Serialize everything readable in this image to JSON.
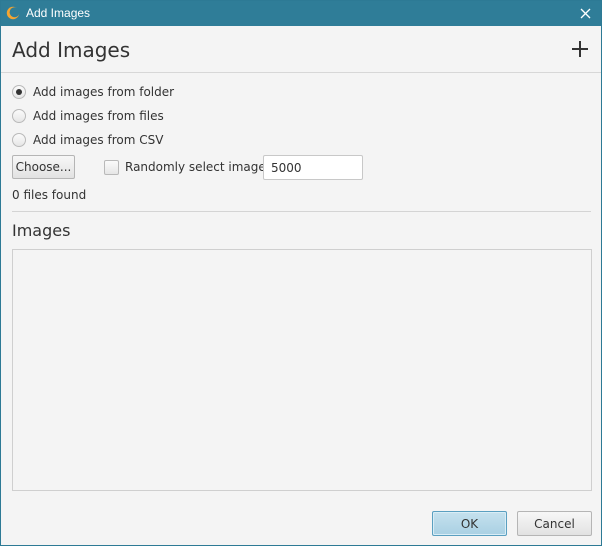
{
  "window": {
    "title": "Add Images",
    "app_icon": "app-logo-icon",
    "close_icon": "close-icon",
    "titlebar_color": "#2f7d98"
  },
  "header": {
    "title": "Add Images",
    "add_icon": "plus-icon"
  },
  "source_options": [
    {
      "label": "Add images from folder",
      "selected": true
    },
    {
      "label": "Add images from files",
      "selected": false
    },
    {
      "label": "Add images from CSV",
      "selected": false
    }
  ],
  "controls": {
    "choose_label": "Choose...",
    "random_select_label": "Randomly select images:",
    "random_select_checked": false,
    "count_value": "5000"
  },
  "status": {
    "files_found": "0 files found"
  },
  "images_section": {
    "heading": "Images",
    "items": []
  },
  "footer": {
    "ok_label": "OK",
    "cancel_label": "Cancel",
    "ok_accent": "#a9d0e3"
  }
}
